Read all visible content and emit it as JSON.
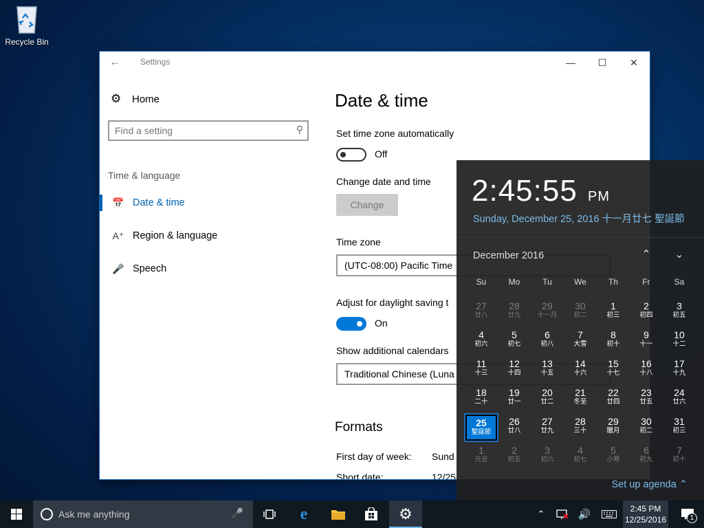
{
  "desktop": {
    "recycle_bin_label": "Recycle Bin"
  },
  "window": {
    "title": "Settings",
    "nav": {
      "home_label": "Home",
      "search_placeholder": "Find a setting",
      "group_label": "Time & language",
      "items": [
        {
          "label": "Date & time",
          "icon": "calendar-clock-icon",
          "active": true
        },
        {
          "label": "Region & language",
          "icon": "language-icon",
          "active": false
        },
        {
          "label": "Speech",
          "icon": "microphone-icon",
          "active": false
        }
      ]
    },
    "main": {
      "heading": "Date & time",
      "auto_timezone_label": "Set time zone automatically",
      "auto_timezone_state": "Off",
      "change_date_label": "Change date and time",
      "change_button": "Change",
      "timezone_label": "Time zone",
      "timezone_value": "(UTC-08:00) Pacific Time",
      "dst_label": "Adjust for daylight saving t",
      "dst_state": "On",
      "calendars_label": "Show additional calendars",
      "calendars_value": "Traditional Chinese (Luna",
      "formats_heading": "Formats",
      "first_day_label": "First day of week:",
      "first_day_value": "Sund",
      "short_date_label": "Short date:",
      "short_date_value": "12/25"
    }
  },
  "flyout": {
    "time": "2:45:55",
    "ampm": "PM",
    "date_line": "Sunday, December 25, 2016 十一月廿七 聖誕節",
    "month_label": "December 2016",
    "weekdays": [
      "Su",
      "Mo",
      "Tu",
      "We",
      "Th",
      "Fr",
      "Sa"
    ],
    "weeks": [
      [
        {
          "n": "27",
          "l": "廿八",
          "dim": true
        },
        {
          "n": "28",
          "l": "廿九",
          "dim": true
        },
        {
          "n": "29",
          "l": "十一月",
          "dim": true
        },
        {
          "n": "30",
          "l": "初二",
          "dim": true
        },
        {
          "n": "1",
          "l": "初三"
        },
        {
          "n": "2",
          "l": "初四"
        },
        {
          "n": "3",
          "l": "初五"
        }
      ],
      [
        {
          "n": "4",
          "l": "初六"
        },
        {
          "n": "5",
          "l": "初七"
        },
        {
          "n": "6",
          "l": "初八"
        },
        {
          "n": "7",
          "l": "大雪"
        },
        {
          "n": "8",
          "l": "初十"
        },
        {
          "n": "9",
          "l": "十一"
        },
        {
          "n": "10",
          "l": "十二"
        }
      ],
      [
        {
          "n": "11",
          "l": "十三"
        },
        {
          "n": "12",
          "l": "十四"
        },
        {
          "n": "13",
          "l": "十五"
        },
        {
          "n": "14",
          "l": "十六"
        },
        {
          "n": "15",
          "l": "十七"
        },
        {
          "n": "16",
          "l": "十八"
        },
        {
          "n": "17",
          "l": "十九"
        }
      ],
      [
        {
          "n": "18",
          "l": "二十"
        },
        {
          "n": "19",
          "l": "廿一"
        },
        {
          "n": "20",
          "l": "廿二"
        },
        {
          "n": "21",
          "l": "冬至"
        },
        {
          "n": "22",
          "l": "廿四"
        },
        {
          "n": "23",
          "l": "廿五"
        },
        {
          "n": "24",
          "l": "廿六"
        }
      ],
      [
        {
          "n": "25",
          "l": "聖誕節",
          "today": true
        },
        {
          "n": "26",
          "l": "廿八"
        },
        {
          "n": "27",
          "l": "廿九"
        },
        {
          "n": "28",
          "l": "三十"
        },
        {
          "n": "29",
          "l": "臘月"
        },
        {
          "n": "30",
          "l": "初二"
        },
        {
          "n": "31",
          "l": "初三"
        }
      ],
      [
        {
          "n": "1",
          "l": "元旦",
          "dim": true
        },
        {
          "n": "2",
          "l": "初五",
          "dim": true
        },
        {
          "n": "3",
          "l": "初六",
          "dim": true
        },
        {
          "n": "4",
          "l": "初七",
          "dim": true
        },
        {
          "n": "5",
          "l": "小寒",
          "dim": true
        },
        {
          "n": "6",
          "l": "初九",
          "dim": true
        },
        {
          "n": "7",
          "l": "初十",
          "dim": true
        }
      ]
    ],
    "agenda_label": "Set up agenda"
  },
  "taskbar": {
    "search_placeholder": "Ask me anything",
    "clock_time": "2:45 PM",
    "clock_date": "12/25/2016",
    "notification_count": "1"
  },
  "colors": {
    "accent": "#0078d7",
    "link": "#7dbbe8",
    "nav_active": "#0063b1"
  }
}
